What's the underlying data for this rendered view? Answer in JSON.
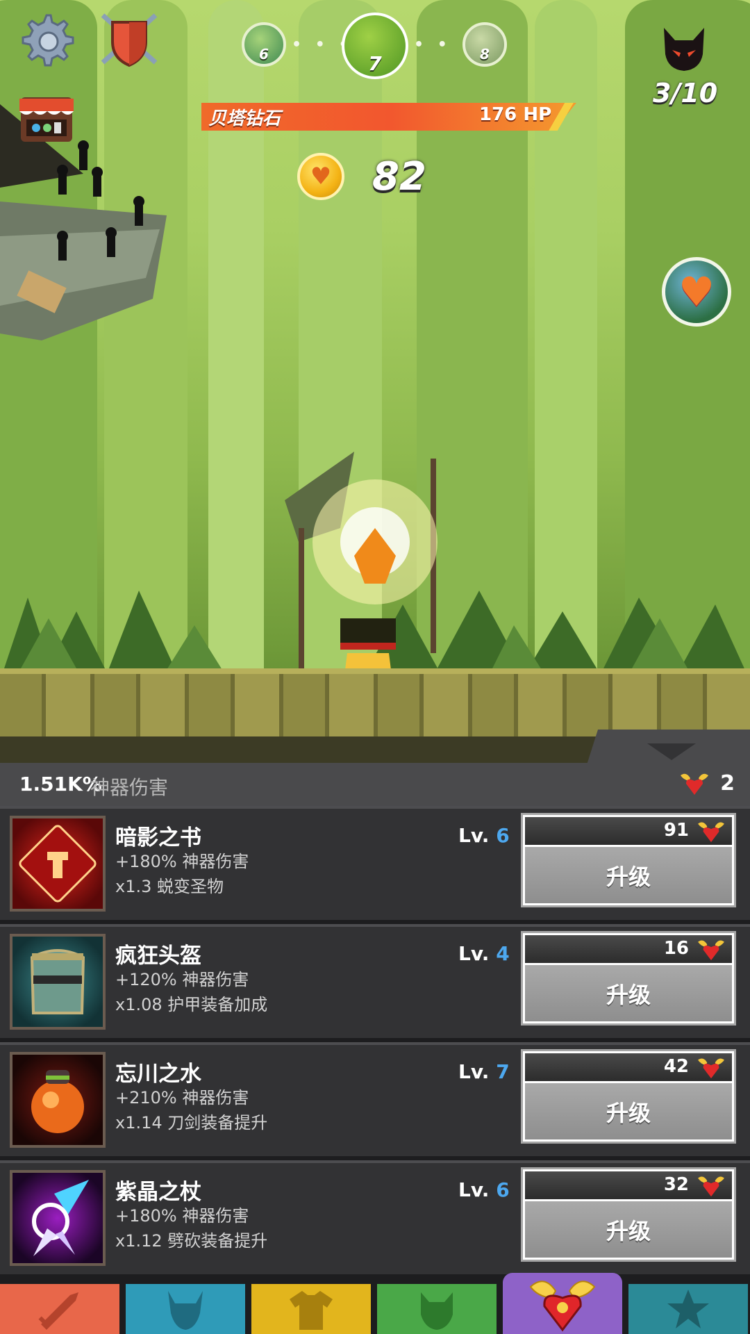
{
  "hud": {
    "stages": [
      {
        "number": "6",
        "state": "previous"
      },
      {
        "number": "7",
        "state": "current"
      },
      {
        "number": "8",
        "state": "next"
      }
    ],
    "boss_name": "贝塔钻石",
    "boss_hp": "176 HP",
    "boss_hp_fraction": 1.0,
    "coins": "82",
    "wave_progress": "3/10"
  },
  "panel": {
    "total_damage_value": "1.51K%",
    "total_damage_label": "神器伤害",
    "gem_balance": "2"
  },
  "artifacts": [
    {
      "name": "暗影之书",
      "bonus": "+180% 神器伤害",
      "effect": "x1.3 蜕变圣物",
      "level_prefix": "Lv.",
      "level": "6",
      "cost": "91",
      "action": "升级",
      "icon": "dark-book-icon"
    },
    {
      "name": "疯狂头盔",
      "bonus": "+120% 神器伤害",
      "effect": "x1.08 护甲装备加成",
      "level_prefix": "Lv.",
      "level": "4",
      "cost": "16",
      "action": "升级",
      "icon": "helmet-icon"
    },
    {
      "name": "忘川之水",
      "bonus": "+210% 神器伤害",
      "effect": "x1.14 刀剑装备提升",
      "level_prefix": "Lv.",
      "level": "7",
      "cost": "42",
      "action": "升级",
      "icon": "potion-jar-icon"
    },
    {
      "name": "紫晶之杖",
      "bonus": "+180% 神器伤害",
      "effect": "x1.12 劈砍装备提升",
      "level_prefix": "Lv.",
      "level": "6",
      "cost": "32",
      "action": "升级",
      "icon": "amethyst-staff-icon"
    }
  ],
  "nav": [
    {
      "icon": "sword-icon",
      "color": "#e8674a"
    },
    {
      "icon": "hero-helmet-icon",
      "color": "#2f9bb8"
    },
    {
      "icon": "shirt-icon",
      "color": "#e2b51d"
    },
    {
      "icon": "pet-icon",
      "color": "#4aa848"
    },
    {
      "icon": "winged-heart-icon",
      "color": "#8e62c8",
      "active": true
    },
    {
      "icon": "star-icon",
      "color": "#2b8a97"
    }
  ],
  "colors": {
    "level_number": "#4da8ef",
    "hp_bar": "#f2572e",
    "panel_bg": "#323234"
  }
}
